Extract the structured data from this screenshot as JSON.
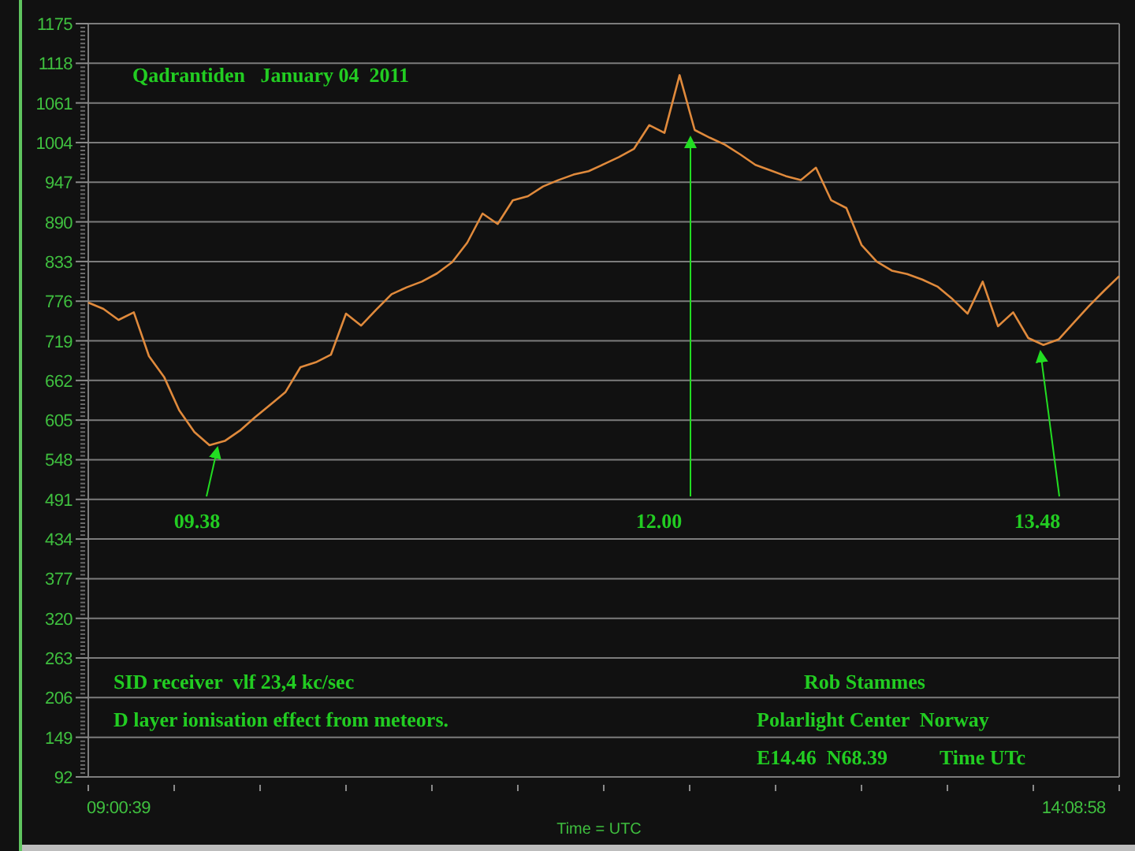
{
  "chart_data": {
    "type": "line",
    "title": "Qadrantiden   January 04  2011",
    "xlabel": "Time = UTC",
    "categories": [
      null,
      null,
      "09:00:39",
      null,
      null,
      null,
      null,
      null,
      null,
      null,
      null,
      null,
      null,
      null,
      null,
      null,
      null,
      null,
      null,
      null,
      null,
      null,
      null,
      null,
      null,
      null,
      null,
      null,
      null,
      null,
      null,
      null,
      null,
      null,
      null,
      null,
      null,
      null,
      null,
      null,
      null,
      null,
      null,
      null,
      null,
      null,
      null,
      null,
      null,
      null,
      null,
      null,
      null,
      null,
      null,
      null,
      null,
      null,
      null,
      null,
      null,
      null,
      null,
      null,
      null,
      "14:08:58",
      null,
      null,
      null
    ],
    "series": [
      {
        "color": "#e08a3c",
        "values": [
          774,
          765,
          749,
          760,
          697,
          667,
          619,
          588,
          569,
          575,
          590,
          609,
          627,
          645,
          681,
          688,
          699,
          758,
          741,
          764,
          786,
          796,
          804,
          816,
          832,
          860,
          902,
          887,
          921,
          927,
          941,
          950,
          958,
          963,
          973,
          983,
          995,
          1029,
          1018,
          1101,
          1022,
          1011,
          1001,
          987,
          972,
          964,
          956,
          950,
          968,
          921,
          910,
          857,
          833,
          820,
          815,
          807,
          797,
          779,
          758,
          804,
          740,
          760,
          723,
          713,
          721,
          745,
          769,
          791,
          812
        ]
      }
    ],
    "ylim": [
      92,
      1175
    ],
    "grid": true,
    "yticks": [
      92,
      149,
      206,
      263,
      320,
      377,
      434,
      491,
      548,
      605,
      662,
      719,
      776,
      833,
      890,
      947,
      1004,
      1061,
      1118,
      1175
    ],
    "annotations": [
      "09.38",
      "12.00",
      "13.48",
      "SID receiver  vlf 23,4 kc/sec",
      "D layer ionisation effect from meteors.",
      "Rob Stammes",
      "Polarlight Center  Norway",
      "E14.46  N68.39",
      "Time UTc"
    ]
  }
}
